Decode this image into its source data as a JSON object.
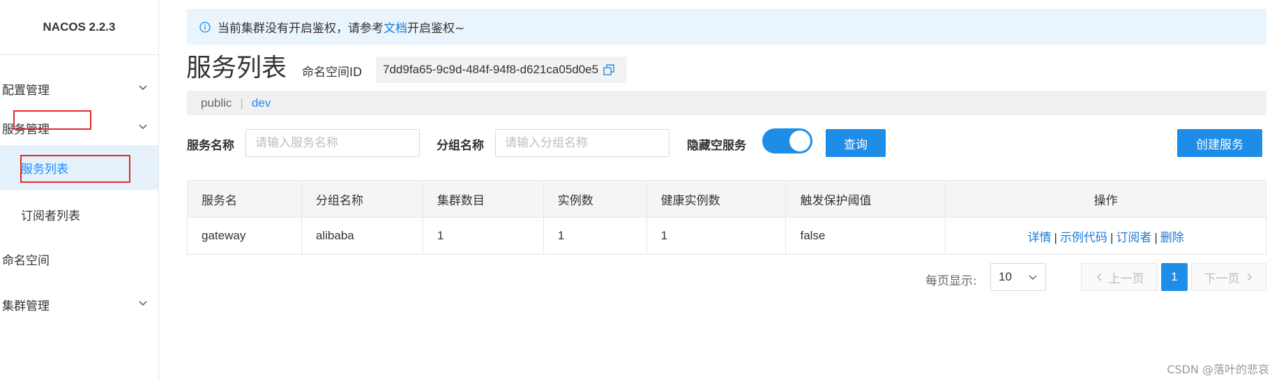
{
  "app": {
    "brand": "NACOS 2.2.3"
  },
  "sidebar": {
    "items": [
      {
        "label": "配置管理"
      },
      {
        "label": "服务管理"
      },
      {
        "label": "服务列表"
      },
      {
        "label": "订阅者列表"
      },
      {
        "label": "命名空间"
      },
      {
        "label": "集群管理"
      }
    ]
  },
  "notice": {
    "text_before": "当前集群没有开启鉴权，请参考",
    "link": "文档",
    "text_after": "开启鉴权~"
  },
  "page": {
    "title": "服务列表",
    "namespace_label": "命名空间ID",
    "namespace_id": "7dd9fa65-9c9d-484f-94f8-d621ca05d0e5"
  },
  "namespaces": {
    "items": [
      "public",
      "dev"
    ],
    "separator": "|",
    "active": "dev"
  },
  "filters": {
    "service_name_label": "服务名称",
    "service_name_placeholder": "请输入服务名称",
    "group_name_label": "分组名称",
    "group_name_placeholder": "请输入分组名称",
    "hide_empty_label": "隐藏空服务",
    "hide_empty_on": true,
    "query_button": "查询",
    "create_button": "创建服务"
  },
  "table": {
    "columns": [
      "服务名",
      "分组名称",
      "集群数目",
      "实例数",
      "健康实例数",
      "触发保护阈值",
      "操作"
    ],
    "rows": [
      {
        "service": "gateway",
        "group": "alibaba",
        "clusters": "1",
        "instances": "1",
        "healthy": "1",
        "threshold": "false",
        "ops": [
          "详情",
          "示例代码",
          "订阅者",
          "删除"
        ]
      }
    ],
    "ops_separator": "|"
  },
  "pagination": {
    "page_size_label": "每页显示:",
    "page_size": "10",
    "prev": "上一页",
    "current_page": "1",
    "next": "下一页"
  },
  "watermark": "CSDN @落叶的悲哀",
  "colors": {
    "primary": "#1e8de8",
    "link": "#1a79d7",
    "annotation_box": "#e52727",
    "notice_bg": "#e9f4fd"
  }
}
